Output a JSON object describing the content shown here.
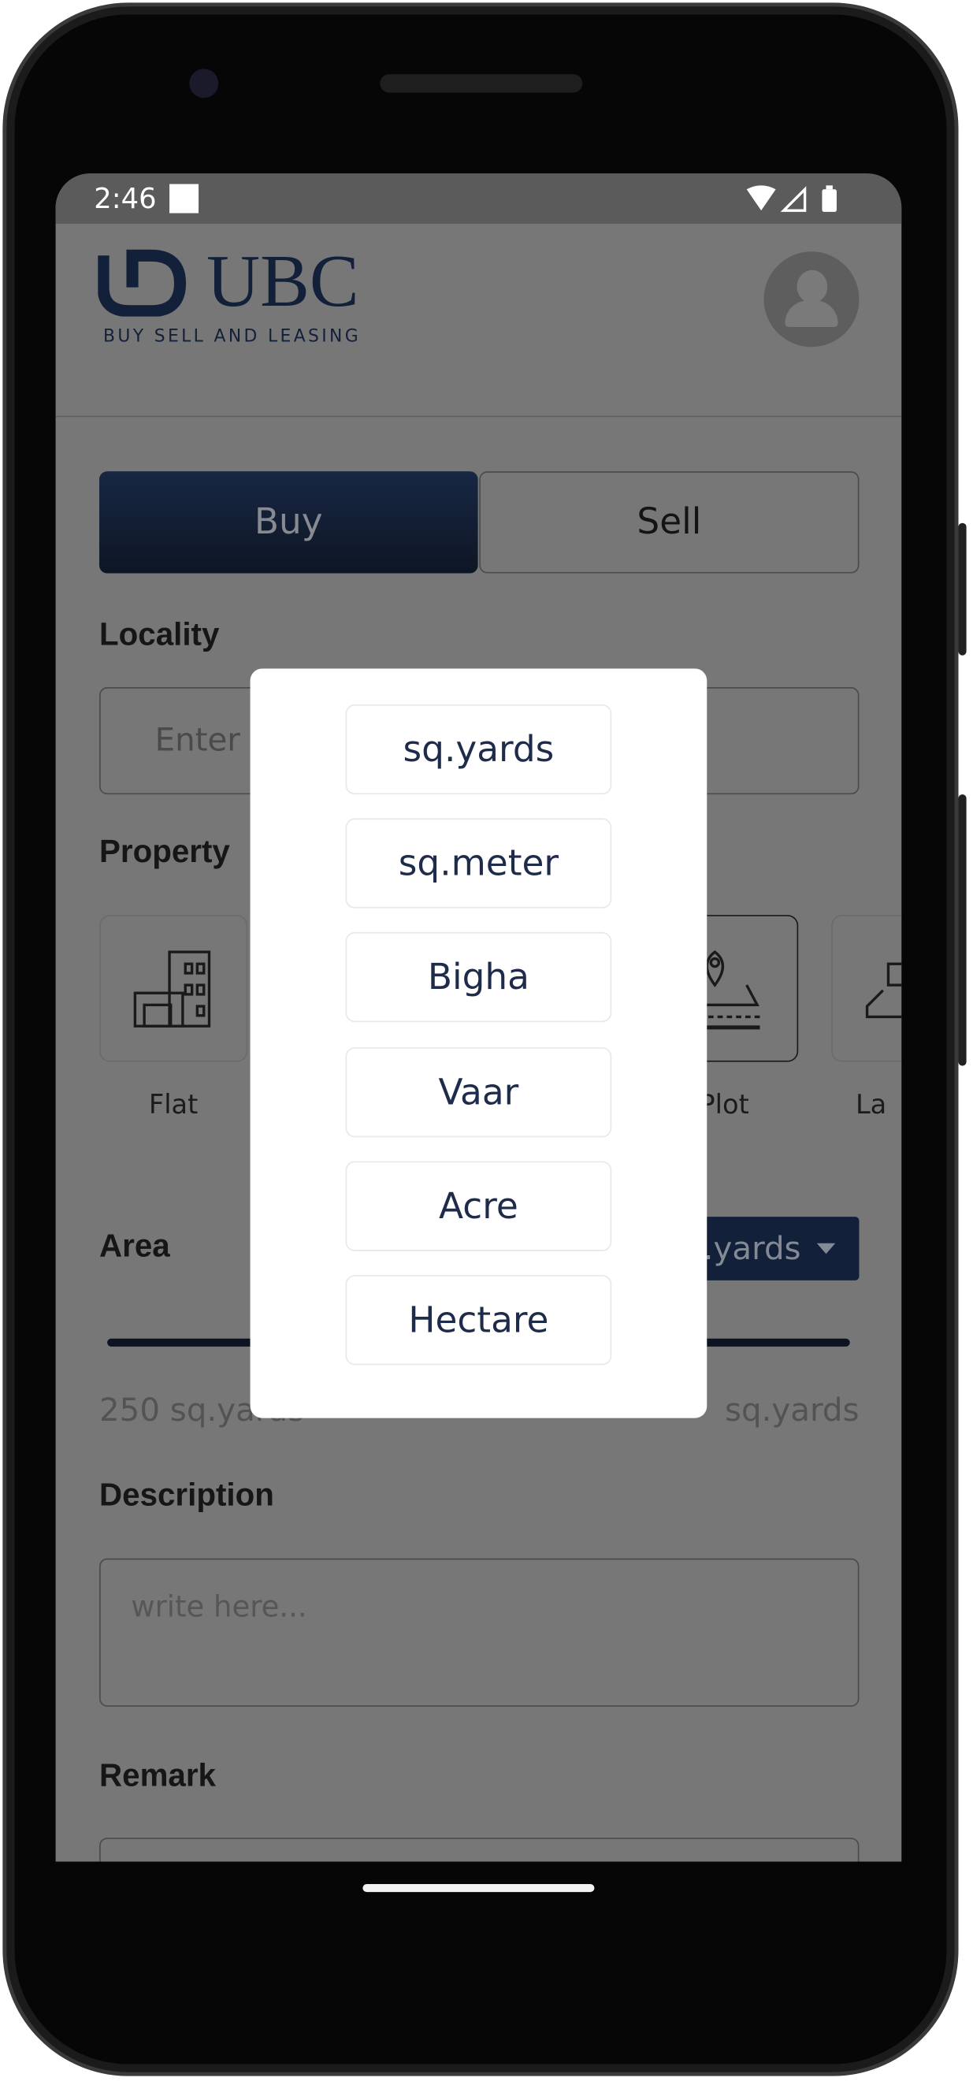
{
  "status_bar": {
    "time": "2:46",
    "icons": [
      "notification-square-icon",
      "wifi-icon",
      "signal-icon",
      "battery-icon"
    ]
  },
  "header": {
    "brand": "UBC",
    "tagline": "BUY SELL AND LEASING",
    "avatar_icon": "user-avatar-icon"
  },
  "mode_toggle": {
    "buy_label": "Buy",
    "sell_label": "Sell",
    "selected": "Buy"
  },
  "locality": {
    "label": "Locality",
    "placeholder": "Enter"
  },
  "property": {
    "label": "Property",
    "types": [
      {
        "label": "Flat",
        "icon": "building-icon"
      },
      {
        "label": "Plot",
        "icon": "plot-location-icon"
      },
      {
        "label": "La",
        "icon": "land-icon"
      }
    ]
  },
  "area": {
    "label": "Area",
    "unit_selected": "sq.yards",
    "min_label": "250 sq.yards",
    "max_label": "sq.yards"
  },
  "description": {
    "label": "Description",
    "placeholder": "write here..."
  },
  "remark": {
    "label": "Remark"
  },
  "unit_picker": {
    "options": [
      "sq.yards",
      "sq.meter",
      "Bigha",
      "Vaar",
      "Acre",
      "Hectare"
    ]
  },
  "colors": {
    "primary": "#13203a",
    "overlay_bg": "#777777",
    "option_text": "#1e2b4b"
  }
}
